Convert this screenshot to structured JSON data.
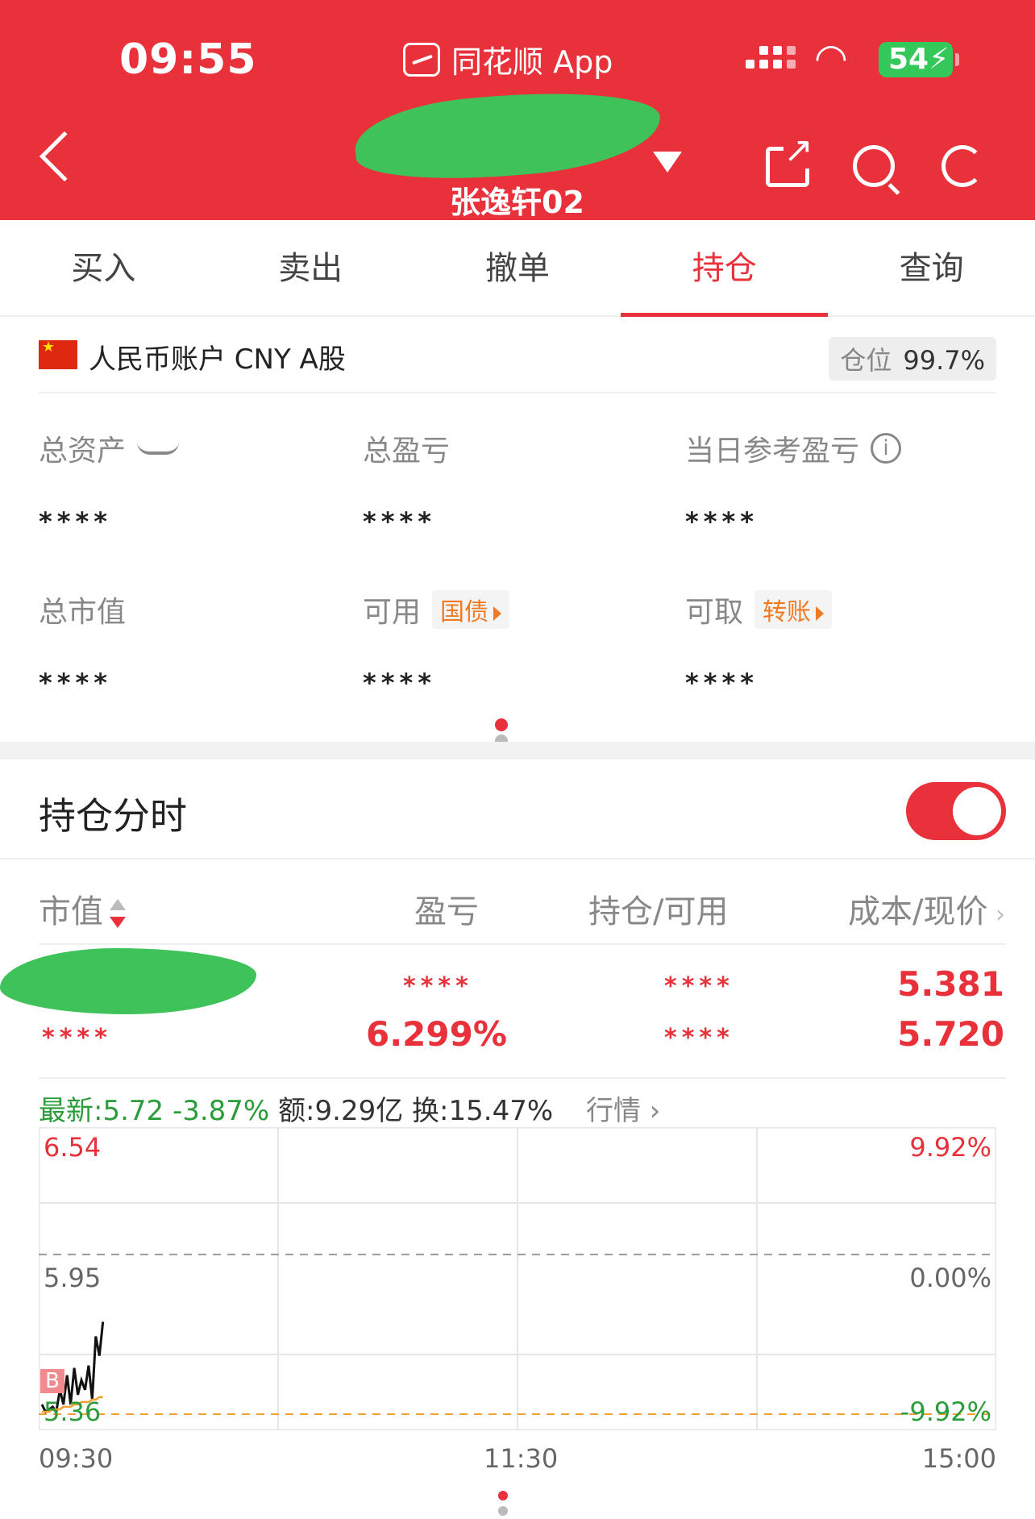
{
  "status_bar": {
    "time": "09:55",
    "app_name": "同花顺 App",
    "battery": "54"
  },
  "header": {
    "account_name": "张逸轩02"
  },
  "tabs": [
    {
      "label": "买入",
      "active": false
    },
    {
      "label": "卖出",
      "active": false
    },
    {
      "label": "撤单",
      "active": false
    },
    {
      "label": "持仓",
      "active": true
    },
    {
      "label": "查询",
      "active": false
    }
  ],
  "account": {
    "label": "人民币账户 CNY A股",
    "position_label": "仓位",
    "position_value": "99.7%"
  },
  "summary": {
    "total_assets": {
      "label": "总资产",
      "value": "****"
    },
    "total_pnl": {
      "label": "总盈亏",
      "value": "****"
    },
    "daily_pnl": {
      "label": "当日参考盈亏",
      "value": "****"
    },
    "market_value": {
      "label": "总市值",
      "value": "****"
    },
    "available": {
      "label": "可用",
      "tag": "国债",
      "value": "****"
    },
    "withdrawable": {
      "label": "可取",
      "tag": "转账",
      "value": "****"
    }
  },
  "holdings": {
    "section_title": "持仓分时",
    "toggle_on": true,
    "columns": [
      "市值",
      "盈亏",
      "持仓/可用",
      "成本/现价"
    ],
    "row": {
      "market_value": "****",
      "pnl": "****",
      "pnl_pct": "6.299%",
      "holding": "****",
      "available": "****",
      "cost": "5.381",
      "price": "5.720"
    }
  },
  "quote": {
    "latest": "最新:5.72 -3.87%",
    "amount": "额:9.29亿",
    "turnover": "换:15.47%",
    "link": "行情"
  },
  "chart_data": {
    "type": "line",
    "y_left_ticks": [
      "6.54",
      "5.95",
      "5.36"
    ],
    "y_right_ticks": [
      "9.92%",
      "0.00%",
      "-9.92%"
    ],
    "x_ticks": [
      "09:30",
      "11:30",
      "15:00"
    ],
    "ylim": [
      5.36,
      6.54
    ],
    "marker": "B",
    "series": [
      {
        "values": [
          5.4,
          5.37,
          5.38,
          5.39,
          5.37,
          5.46,
          5.4,
          5.52,
          5.4,
          5.55,
          5.44,
          5.5,
          5.46,
          5.56,
          5.42,
          5.68,
          5.6,
          5.74
        ]
      },
      {
        "values": [
          5.37,
          5.37,
          5.37,
          5.38,
          5.38,
          5.38,
          5.39,
          5.39,
          5.39,
          5.4,
          5.4,
          5.41,
          5.41,
          5.41,
          5.42,
          5.42,
          5.43,
          5.43
        ]
      }
    ],
    "colors": {
      "price": "#111111",
      "avg": "#f0a030",
      "up": "#e8313a",
      "down": "#2a9d3a"
    }
  },
  "pager": {
    "top_active": 0,
    "bottom_active": 0
  }
}
